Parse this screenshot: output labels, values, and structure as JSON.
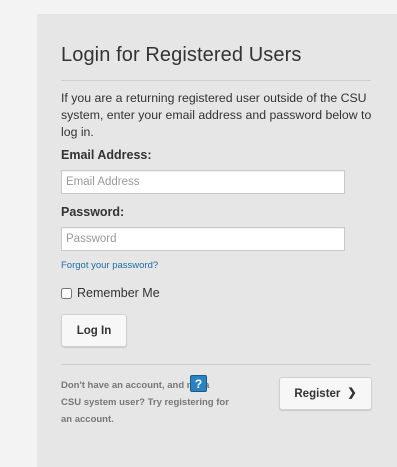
{
  "login": {
    "title": "Login for Registered Users",
    "intro": "If you are a returning registered user outside of the CSU system, enter your email address and password below to log in.",
    "email_label": "Email Address:",
    "email_placeholder": "Email Address",
    "email_value": "",
    "password_label": "Password:",
    "password_placeholder": "Password",
    "password_value": "",
    "forgot_link": "Forgot your password?",
    "remember_label": "Remember Me",
    "remember_checked": false,
    "login_button": "Log In"
  },
  "register": {
    "help_text": "Don't have an account, and not a CSU system user? Try registering for an account.",
    "help_icon_glyph": "?",
    "button_label": "Register",
    "button_chevron": "❯"
  },
  "colors": {
    "panel_background": "#e6e6e6",
    "link": "#1a6fa3",
    "help_icon": "#2a83c0"
  },
  "icons": {
    "help": "question-mark-icon",
    "register_chevron": "chevron-right-icon"
  }
}
